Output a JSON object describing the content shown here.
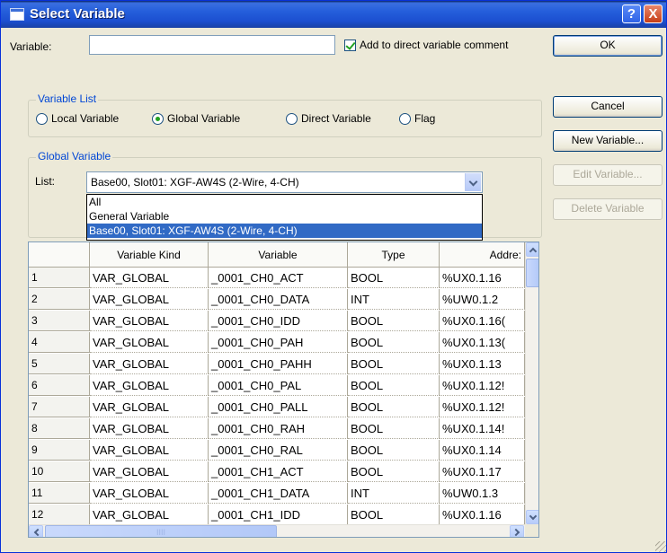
{
  "window": {
    "title": "Select Variable",
    "help_label": "?",
    "close_label": "X"
  },
  "variable": {
    "label": "Variable:",
    "value": "",
    "add_comment_label": "Add to direct variable comment",
    "add_comment_checked": true
  },
  "buttons": {
    "ok": "OK",
    "cancel": "Cancel",
    "new_variable": "New Variable...",
    "edit_variable": "Edit Variable...",
    "delete_variable": "Delete Variable"
  },
  "variable_list": {
    "title": "Variable List",
    "options": [
      "Local Variable",
      "Global Variable",
      "Direct Variable",
      "Flag"
    ],
    "selected": "Global Variable"
  },
  "global_variable": {
    "title": "Global Variable",
    "list_label": "List:",
    "selected": "Base00, Slot01: XGF-AW4S (2-Wire, 4-CH)",
    "options": [
      "All",
      "General Variable",
      "Base00, Slot01: XGF-AW4S (2-Wire, 4-CH)"
    ]
  },
  "table": {
    "columns": [
      "",
      "Variable Kind",
      "Variable",
      "Type",
      "Addre:"
    ],
    "rows": [
      [
        "1",
        "VAR_GLOBAL",
        "_0001_CH0_ACT",
        "BOOL",
        "%UX0.1.16"
      ],
      [
        "2",
        "VAR_GLOBAL",
        "_0001_CH0_DATA",
        "INT",
        "%UW0.1.2"
      ],
      [
        "3",
        "VAR_GLOBAL",
        "_0001_CH0_IDD",
        "BOOL",
        "%UX0.1.16("
      ],
      [
        "4",
        "VAR_GLOBAL",
        "_0001_CH0_PAH",
        "BOOL",
        "%UX0.1.13("
      ],
      [
        "5",
        "VAR_GLOBAL",
        "_0001_CH0_PAHH",
        "BOOL",
        "%UX0.1.13"
      ],
      [
        "6",
        "VAR_GLOBAL",
        "_0001_CH0_PAL",
        "BOOL",
        "%UX0.1.12!"
      ],
      [
        "7",
        "VAR_GLOBAL",
        "_0001_CH0_PALL",
        "BOOL",
        "%UX0.1.12!"
      ],
      [
        "8",
        "VAR_GLOBAL",
        "_0001_CH0_RAH",
        "BOOL",
        "%UX0.1.14!"
      ],
      [
        "9",
        "VAR_GLOBAL",
        "_0001_CH0_RAL",
        "BOOL",
        "%UX0.1.14"
      ],
      [
        "10",
        "VAR_GLOBAL",
        "_0001_CH1_ACT",
        "BOOL",
        "%UX0.1.17"
      ],
      [
        "11",
        "VAR_GLOBAL",
        "_0001_CH1_DATA",
        "INT",
        "%UW0.1.3"
      ],
      [
        "12",
        "VAR_GLOBAL",
        "_0001_CH1_IDD",
        "BOOL",
        "%UX0.1.16"
      ]
    ]
  },
  "scroll": {
    "hthumb_grip": "IIII"
  }
}
